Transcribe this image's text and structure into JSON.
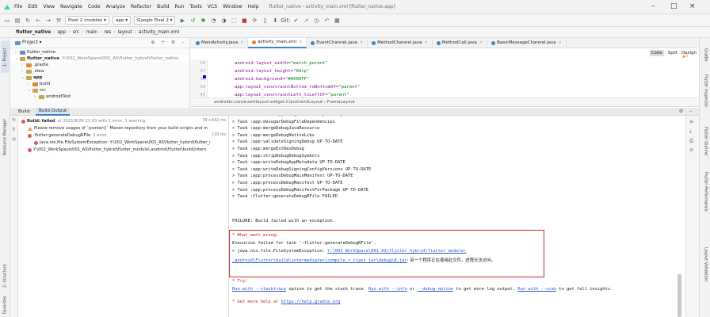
{
  "menubar": {
    "items": [
      "File",
      "Edit",
      "View",
      "Navigate",
      "Code",
      "Analyze",
      "Refactor",
      "Build",
      "Run",
      "Tools",
      "VCS",
      "Window",
      "Help"
    ],
    "window_title": "flutter_native - activity_main.xml [flutter_native.app]",
    "minimize": "–",
    "maximize": "□",
    "close": "×"
  },
  "toolbar": {
    "device": "Pixel 2 (mobile)",
    "config": "app",
    "emulator": "Google Pixel 2"
  },
  "breadcrumb": [
    "flutter_native",
    "app",
    "src",
    "main",
    "res",
    "layout",
    "activity_main.xml"
  ],
  "project": {
    "view_label": "Project",
    "items": [
      {
        "label": "flutter_native",
        "indent": 0,
        "arrow": "›",
        "color": "blue"
      },
      {
        "label": "flutter_native",
        "extra": "Y:\\002_WorkSpace\\001_AS\\flutter_hybrid\\flutter_native",
        "indent": 0,
        "arrow": "⌄",
        "color": "yellow",
        "bold": true
      },
      {
        "label": ".gradle",
        "indent": 1,
        "arrow": "›",
        "color": "orange"
      },
      {
        "label": ".idea",
        "indent": 1,
        "arrow": "›",
        "color": "yellow"
      },
      {
        "label": "app",
        "indent": 1,
        "arrow": "⌄",
        "color": "yellow",
        "bold": true
      },
      {
        "label": "build",
        "indent": 2,
        "arrow": "›",
        "color": "orange"
      },
      {
        "label": "src",
        "indent": 2,
        "arrow": "⌄",
        "color": "yellow"
      },
      {
        "label": "androidTest",
        "indent": 3,
        "arrow": "›",
        "color": "yellow"
      }
    ]
  },
  "editor": {
    "tabs": [
      {
        "label": "MainActivity.java",
        "color": "#3a86c8",
        "active": false
      },
      {
        "label": "activity_main.xml",
        "color": "#d4843e",
        "active": true
      },
      {
        "label": "EventChannel.java",
        "color": "#3a86c8",
        "active": false
      },
      {
        "label": "MethodChannel.java",
        "color": "#3a86c8",
        "active": false
      },
      {
        "label": "MethodCall.java",
        "color": "#3a86c8",
        "active": false
      },
      {
        "label": "BasicMessageChannel.java",
        "color": "#3a86c8",
        "active": false
      }
    ],
    "view_modes": [
      "Code",
      "Split",
      "Design"
    ],
    "warning_count": "▲3",
    "line_numbers": [
      "36",
      "37",
      "38",
      "39",
      "40"
    ],
    "lines": [
      {
        "attr": "android:layout_width=",
        "value": "\"match_parent\""
      },
      {
        "attr": "android:layout_height=",
        "value": "\"0dip\""
      },
      {
        "attr": "android:background=",
        "value": "\"#0000FF\""
      },
      {
        "attr": "app:layout_constraintBottom_toBottomOf=",
        "value": "\"parent\""
      },
      {
        "attr": "app:layout_constraintLeft_toLeftOf=",
        "value": "\"parent\""
      }
    ],
    "breadcrumb": "androidx.constraintlayout.widget.ConstraintLayout  ›  FrameLayout"
  },
  "build": {
    "header": "Build:",
    "tabs": [
      "Build Output"
    ],
    "tree": [
      {
        "label": "Build: failed",
        "suffix": "at 2021/8/29 21:03 with 1 error, 1 warning",
        "time": "39 s 642 ms",
        "kind": "error",
        "indent": 0
      },
      {
        "label": "Please remove usages of `jcenter()` Maven repository from your build scripts and m",
        "kind": "warning",
        "indent": 1
      },
      {
        "label": ":flutter:generateDebugRFile",
        "suffix": "1 error",
        "time": "110 ms",
        "kind": "error",
        "indent": 1
      },
      {
        "label": "java.nio.file.FileSystemException: Y:\\002_WorkSpace\\001_AS\\flutter_hybrid\\flutter_i",
        "kind": "error",
        "indent": 2
      },
      {
        "label": "Y:\\002_WorkSpace\\001_AS\\flutter_hybrid\\flutter_module\\.android\\Flutter\\build\\intern",
        "kind": "error",
        "indent": 1
      }
    ]
  },
  "console": {
    "lines": [
      "> Task :flutter:copyDebugJniLibsProjectOnly UP-TO-DATE",
      "> Task :app:desugarDebugFileDependencies",
      "> Task :app:mergeDebugJavaResource",
      "> Task :app:mergeDebugNativeLibs",
      "> Task :app:validateSigningDebug UP-TO-DATE",
      "> Task :app:mergeExtDexDebug",
      "> Task :app:stripDebugDebugSymbols",
      "> Task :app:writeDebugAppMetadata UP-TO-DATE",
      "> Task :app:writeDebugSigningConfigVersions UP-TO-DATE",
      "> Task :app:processDebugMainManifest UP-TO-DATE",
      "> Task :app:processDebugManifest UP-TO-DATE",
      "> Task :app:processDebugManifestForPackage UP-TO-DATE",
      "> Task :flutter:generateDebugRFile FAILED",
      "FAILURE: Build failed with an exception."
    ],
    "error_block": {
      "what_went_wrong": "* What went wrong:",
      "execution_failed": "Execution failed for task ':flutter:generateDebugRFile'.",
      "exception_prefix": "> java.nio.file.FileSystemException: ",
      "exception_path": "Y:\\002_WorkSpace\\001_AS\\flutter_hybrid\\flutter_module\\",
      "exception_path2": ".android\\Flutter\\build\\intermediates\\compile_r_class_jar\\debug\\R.jar",
      "exception_msg": ": 另一个程序正在使用此文件，进程无法访问。"
    },
    "try": {
      "header": "* Try:",
      "run_with": "Run with ",
      "stacktrace": "--stacktrace",
      "mid1": " option to get the stack trace. ",
      "run_with2": "Run with ",
      "info": "--info",
      "or": " or ",
      "debug": "--debug option",
      "mid2": " to get more log output. ",
      "run_with3": "Run with ",
      "scan": "--scan",
      "end": " to get full insights.",
      "help_prefix": "* Get more help at ",
      "help_link": "https://help.gradle.org"
    }
  },
  "left_stripe": [
    "1: Project",
    "Resource Manager",
    "2: Structure",
    "Favorites"
  ],
  "right_stripe": [
    "Gradle",
    "Flutter Inspector",
    "Flutter Outline",
    "Flutter Performance",
    "Layout Validation"
  ]
}
